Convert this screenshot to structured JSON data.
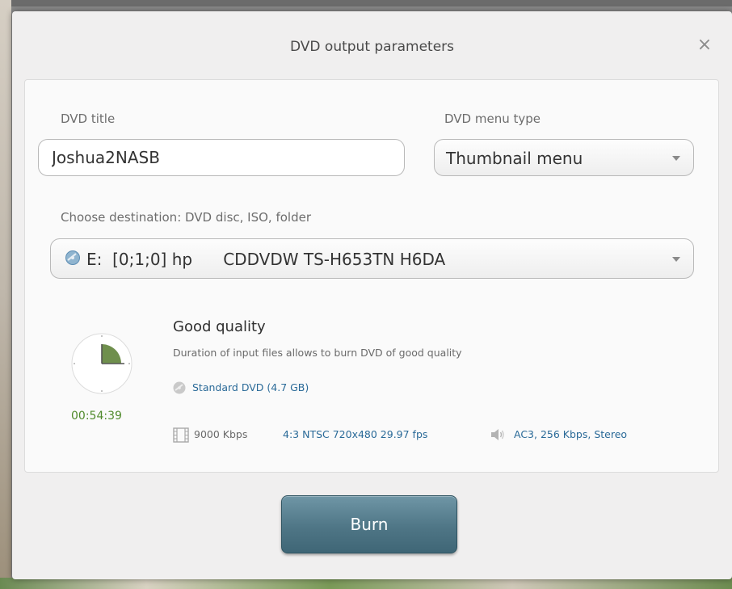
{
  "dialog": {
    "title": "DVD output parameters",
    "close_glyph": "×"
  },
  "form": {
    "dvd_title_label": "DVD title",
    "dvd_title_value": "Joshua2NASB",
    "menu_type_label": "DVD menu type",
    "menu_type_value": "Thumbnail menu",
    "destination_label": "Choose destination: DVD disc, ISO, folder",
    "destination_value": "E:  [0;1;0] hp      CDDVDW TS-H653TN H6DA"
  },
  "quality": {
    "title": "Good quality",
    "description": "Duration of input files allows to burn DVD of good quality",
    "duration": "00:54:39",
    "dvd_size": "Standard DVD (4.7 GB)",
    "bitrate": "9000 Kbps",
    "video_spec": "4:3  NTSC 720x480 29.97 fps",
    "audio_spec": "AC3, 256 Kbps, Stereo",
    "disc_fill_fraction": 0.21
  },
  "actions": {
    "burn_label": "Burn"
  },
  "colors": {
    "duration_green": "#4f8a2b",
    "link_blue": "#2a6a98",
    "clock_fill": "#6f8f4d",
    "button_teal": "#4f7686"
  },
  "icons": [
    "close-icon",
    "chevron-down-icon",
    "disc-icon",
    "clock-icon",
    "film-icon",
    "speaker-icon"
  ]
}
